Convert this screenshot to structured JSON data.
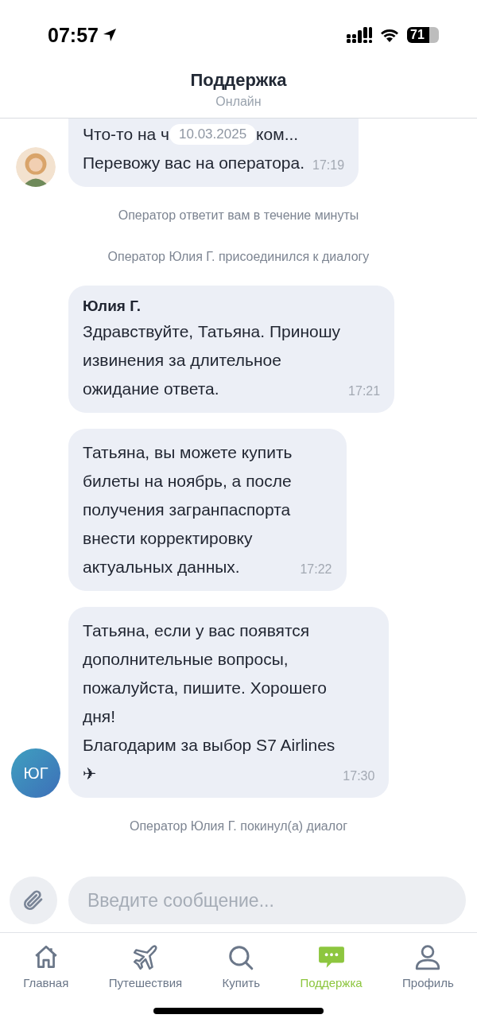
{
  "status_bar": {
    "time": "07:57",
    "battery": "71"
  },
  "header": {
    "title": "Поддержка",
    "subtitle": "Онлайн"
  },
  "chat": {
    "date": "10.03.2025",
    "messages": [
      {
        "kind": "photo_bubble",
        "cut_line": {
          "start": "Что-то на ч",
          "end": "ком..."
        },
        "text": "Перевожу вас на оператора.",
        "time": "17:19"
      },
      {
        "kind": "system",
        "text": "Оператор ответит вам в течение минуты"
      },
      {
        "kind": "system",
        "text": "Оператор Юлия Г. присоединился к диалогу"
      },
      {
        "kind": "bubble",
        "author": "Юлия Г.",
        "text": "Здравствуйте, Татьяна. Приношу\nизвинения за длительное\nожидание ответа.",
        "time": "17:21"
      },
      {
        "kind": "bubble",
        "text": "Татьяна, вы можете купить\nбилеты на ноябрь, а после\nполучения загранпаспорта\nвнести корректировку\nактуальных данных.",
        "time": "17:22"
      },
      {
        "kind": "initials_bubble",
        "initials": "ЮГ",
        "text": "Татьяна, если у вас появятся\nдополнительные вопросы,\nпожалуйста, пишите. Хорошего\nдня!\nБлагодарим за выбор S7 Airlines\n✈",
        "time": "17:30"
      },
      {
        "kind": "system",
        "text": "Оператор Юлия Г. покинул(а) диалог"
      }
    ]
  },
  "composer": {
    "placeholder": "Введите сообщение..."
  },
  "tabs": [
    {
      "label": "Главная",
      "selected": false
    },
    {
      "label": "Путешествия",
      "selected": false
    },
    {
      "label": "Купить",
      "selected": false
    },
    {
      "label": "Поддержка",
      "selected": true
    },
    {
      "label": "Профиль",
      "selected": false
    }
  ]
}
